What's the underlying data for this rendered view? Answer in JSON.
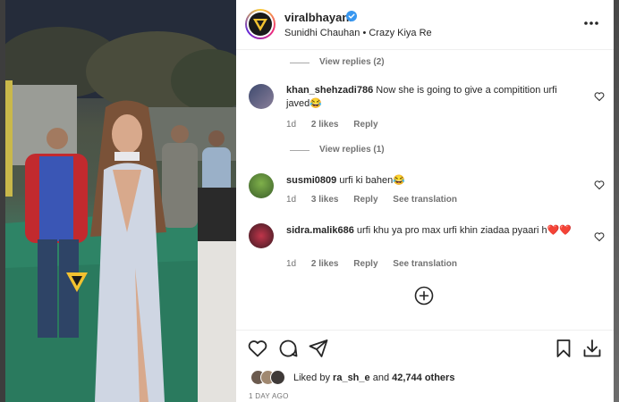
{
  "post": {
    "username": "viralbhayani",
    "subline": "Sunidhi Chauhan • Crazy Kiya Re",
    "date": "1 DAY AGO"
  },
  "view_replies": [
    "View replies (2)",
    "View replies (1)"
  ],
  "comments": [
    {
      "user": "khan_shehzadi786",
      "text": "Now she is going to give a compitition urfi javed😂",
      "time": "1d",
      "likes": "2 likes",
      "reply": "Reply",
      "translate": ""
    },
    {
      "user": "susmi0809",
      "text": "urfi ki bahen😂",
      "time": "1d",
      "likes": "3 likes",
      "reply": "Reply",
      "translate": "See translation"
    },
    {
      "user": "sidra.malik686",
      "text": "urfi khu ya pro max urfi khin ziadaa pyaari h❤️❤️",
      "time": "1d",
      "likes": "2 likes",
      "reply": "Reply",
      "translate": "See translation"
    }
  ],
  "likes_bar": {
    "prefix": "Liked by",
    "user": "ra_sh_e",
    "middle": "and",
    "count": "42,744 others"
  },
  "icons": {
    "more": "more-horizontal-icon",
    "verified": "verified-badge-icon",
    "heart": "heart-icon",
    "comment": "comment-icon",
    "share": "share-icon",
    "save": "bookmark-icon",
    "download": "download-icon",
    "add": "add-comment-icon"
  },
  "colors": {
    "verified_blue": "#3897f0",
    "text_primary": "#262626",
    "text_secondary": "#737373"
  }
}
